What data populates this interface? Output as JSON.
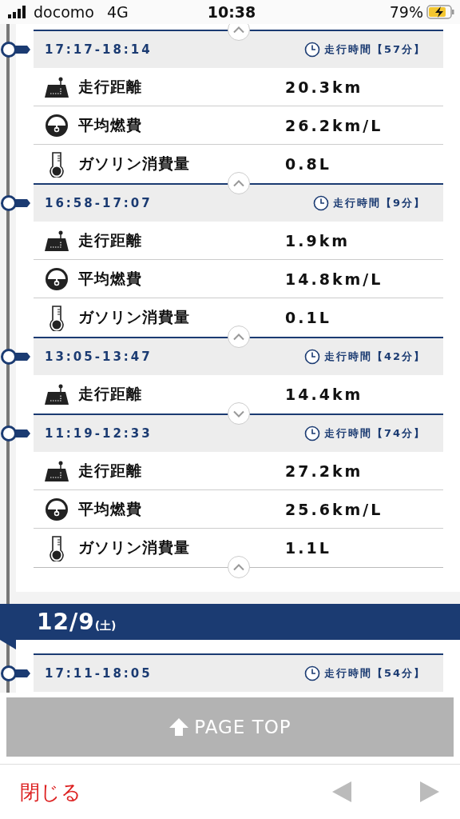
{
  "status_bar": {
    "carrier": "docomo",
    "network": "4G",
    "time": "10:38",
    "battery": "79%"
  },
  "top_toggle": {
    "expanded": true
  },
  "sections": [
    {
      "trips": [
        {
          "time_range": "17:17-18:14",
          "duration": "走行時間【57分】",
          "expanded": true,
          "rows": [
            {
              "kind": "distance",
              "label": "走行距離",
              "value": "20.3km"
            },
            {
              "kind": "economy",
              "label": "平均燃費",
              "value": "26.2km/L"
            },
            {
              "kind": "fuel",
              "label": "ガソリン消費量",
              "value": "0.8L"
            }
          ]
        },
        {
          "time_range": "16:58-17:07",
          "duration": "走行時間【9分】",
          "expanded": true,
          "rows": [
            {
              "kind": "distance",
              "label": "走行距離",
              "value": "1.9km"
            },
            {
              "kind": "economy",
              "label": "平均燃費",
              "value": "14.8km/L"
            },
            {
              "kind": "fuel",
              "label": "ガソリン消費量",
              "value": "0.1L"
            }
          ]
        },
        {
          "time_range": "13:05-13:47",
          "duration": "走行時間【42分】",
          "expanded": false,
          "rows": [
            {
              "kind": "distance",
              "label": "走行距離",
              "value": "14.4km"
            }
          ]
        },
        {
          "time_range": "11:19-12:33",
          "duration": "走行時間【74分】",
          "expanded": true,
          "rows": [
            {
              "kind": "distance",
              "label": "走行距離",
              "value": "27.2km"
            },
            {
              "kind": "economy",
              "label": "平均燃費",
              "value": "25.6km/L"
            },
            {
              "kind": "fuel",
              "label": "ガソリン消費量",
              "value": "1.1L"
            }
          ]
        }
      ]
    },
    {
      "date": "12/9",
      "weekday": "(土)",
      "trips": [
        {
          "time_range": "17:11-18:05",
          "duration": "走行時間【54分】"
        }
      ]
    }
  ],
  "page_top": "PAGE TOP",
  "toolbar": {
    "close": "閉じる"
  }
}
